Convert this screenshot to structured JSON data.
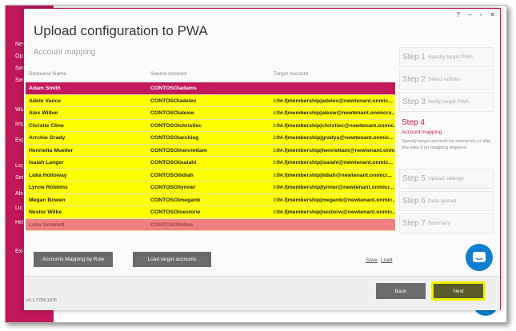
{
  "background": {
    "sidebar_items": [
      "New",
      "Op",
      "Sav",
      "Sav",
      "Wiz",
      "Imp",
      "Exp",
      "Log",
      "Set",
      "Abo",
      "Lic",
      "Hel",
      "Exit"
    ]
  },
  "dialog": {
    "title": "Upload configuration to PWA",
    "subtitle": "Account mapping",
    "window_controls": [
      "?",
      "–",
      "▫",
      "✕"
    ],
    "grid": {
      "columns": [
        "Resource Name",
        "Source Account",
        "Target Account"
      ],
      "rows": [
        {
          "name": "Adam Smith",
          "source": "CONTOSO\\adams",
          "target": "",
          "state": "selected"
        },
        {
          "name": "Adele Vance",
          "source": "CONTOSO\\adelev",
          "target": "i:0#.f|membership|adelev@newtenant.onmic...",
          "state": "highlighted"
        },
        {
          "name": "Alex Wilber",
          "source": "CONTOSO\\alexw",
          "target": "i:0#.f|membership|alexw@newtenant.onmicro...",
          "state": "highlighted"
        },
        {
          "name": "Christie Cline",
          "source": "CONTOSO\\christiec",
          "target": "i:0#.f|membership|christiec@newtenant.onmic...",
          "state": "highlighted"
        },
        {
          "name": "Arrchie Grady",
          "source": "CONTOSO\\archieg",
          "target": "i:0#.f|membership|gradya@newtenant.onmic...",
          "state": "highlighted"
        },
        {
          "name": "Henrietta Mueller",
          "source": "CONTOSO\\henriettam",
          "target": "i:0#.f|membership|henriettam@newtenant.onm...",
          "state": "highlighted"
        },
        {
          "name": "Isaiah Langer",
          "source": "CONTOSO\\isaiahl",
          "target": "i:0#.f|membership|isaiahl@newtenant.onmic...",
          "state": "highlighted"
        },
        {
          "name": "Lidia Holloway",
          "source": "CONTOSO\\lidiah",
          "target": "i:0#.f|membership|lidiah@newtenant.onmicr...",
          "state": "highlighted"
        },
        {
          "name": "Lynne Robbins",
          "source": "CONTOSO\\lynner",
          "target": "i:0#.f|membership|lynner@newtenant.onmicr...",
          "state": "highlighted"
        },
        {
          "name": "Megan Bowen",
          "source": "CONTOSO\\meganb",
          "target": "i:0#.f|membership|meganb@newtenant.onmic...",
          "state": "highlighted"
        },
        {
          "name": "Nestor Wilke",
          "source": "CONTOSO\\nestorw",
          "target": "i:0#.f|membership|nestorw@newtenant.onmic...",
          "state": "highlighted"
        },
        {
          "name": "Lidia Schmidt",
          "source": "CONTOSO\\lidias",
          "target": "",
          "state": "unmapped"
        }
      ]
    },
    "buttons": {
      "mapping_by_rule": "Accounts Mapping by Rule",
      "load_target": "Load target accounts",
      "save_link": "Save",
      "load_link": "Load",
      "back": "Back",
      "next": "Next"
    },
    "version": "v5.1.7789.1976",
    "steps": [
      {
        "num": "Step 1",
        "label": "Specify target PWA"
      },
      {
        "num": "Step 2",
        "label": "Select entities"
      },
      {
        "num": "Step 3",
        "label": "Verify target PWA"
      },
      {
        "num": "Step 4",
        "label": "Account mapping",
        "active": true,
        "desc": "Specify target account for resources or skip this step if no mapping required."
      },
      {
        "num": "Step 5",
        "label": "Upload settings"
      },
      {
        "num": "Step 6",
        "label": "Data upload"
      },
      {
        "num": "Step 7",
        "label": "Summary"
      }
    ]
  },
  "colors": {
    "accent": "#c2185b",
    "row_selected": "#c2185b",
    "row_highlight": "#ffff00",
    "row_unmapped": "#f08080",
    "chat": "#0a7fd0",
    "next_highlight": "#f0f000"
  }
}
